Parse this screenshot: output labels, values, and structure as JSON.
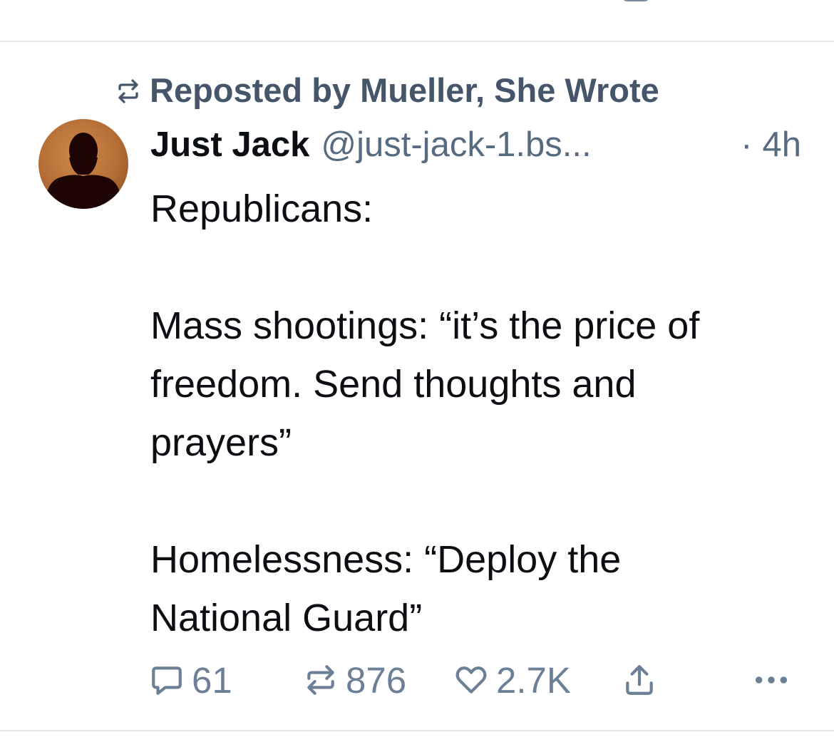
{
  "repost": {
    "label": "Reposted by Mueller, She Wrote"
  },
  "post": {
    "author_name": "Just Jack",
    "author_handle": "@just-jack-1.bs...",
    "separator": "·",
    "timestamp": "4h",
    "text": "Republicans:\n\nMass shootings: “it’s the price of\nfreedom. Send thoughts and\nprayers”\n\nHomelessness: “Deploy the\nNational Guard”",
    "reply_count": "61",
    "repost_count": "876",
    "like_count": "2.7K"
  },
  "icons": {
    "repost": "repost-arrows-icon",
    "reply": "speech-bubble-icon",
    "like": "heart-icon",
    "share": "share-upload-icon",
    "more": "ellipsis-icon"
  },
  "colors": {
    "secondary_text": "#566b80",
    "action_icon": "#6b7f96",
    "repost_label": "#45566b",
    "divider": "#e3e7eb"
  }
}
